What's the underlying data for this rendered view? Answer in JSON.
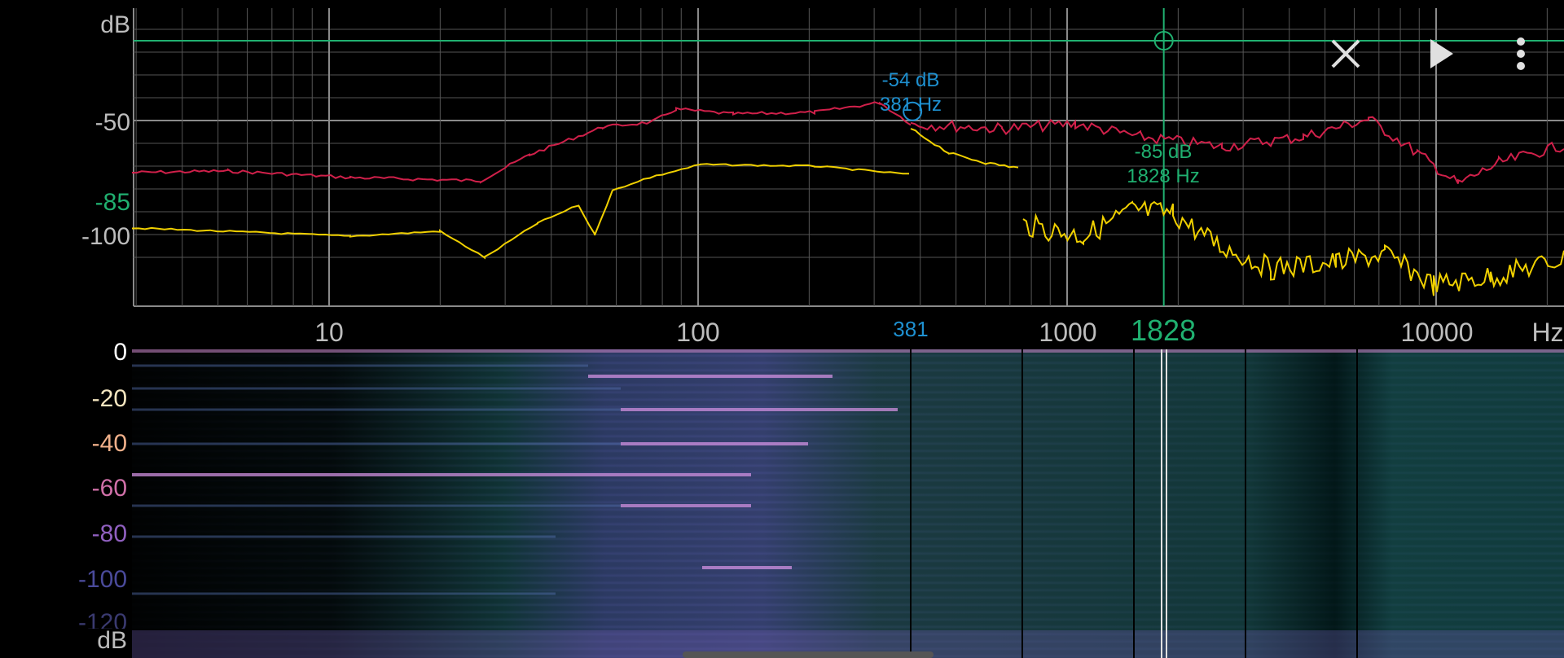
{
  "colors": {
    "grid": "#555555",
    "grid_major": "#8a8a8a",
    "axis_text": "#bdbdbd",
    "red_trace": "#d0204a",
    "yellow_trace": "#f0d000",
    "marker_blue": "#1e90d0",
    "marker_green": "#20b070"
  },
  "analyzer": {
    "y_unit": "dB",
    "y_ticks": [
      "-50",
      "-100"
    ],
    "highlighted_y_tick": "-85",
    "x_ticks": [
      "10",
      "100",
      "1000",
      "10000"
    ],
    "x_unit": "Hz",
    "cursor_freq_label": "381",
    "cursor_freq2_label": "1828",
    "marker1": {
      "db_label": "-54 dB",
      "hz_label": "381 Hz",
      "freq": 381,
      "db": -54
    },
    "marker2": {
      "db_label": "-85 dB",
      "hz_label": "1828 Hz",
      "freq": 1828,
      "db": -85
    }
  },
  "toolbar": {
    "close_icon": "close-icon",
    "play_icon": "play-icon",
    "menu_icon": "more-vert-icon"
  },
  "spectrogram": {
    "labels": [
      "0",
      "-20",
      "-40",
      "-60",
      "-80",
      "-100",
      "-120"
    ],
    "label_colors": [
      "#ffffff",
      "#f5e6c0",
      "#f0b08a",
      "#d070a8",
      "#9060c0",
      "#4a4a9a",
      "#3a3a70"
    ],
    "unit": "dB"
  }
}
